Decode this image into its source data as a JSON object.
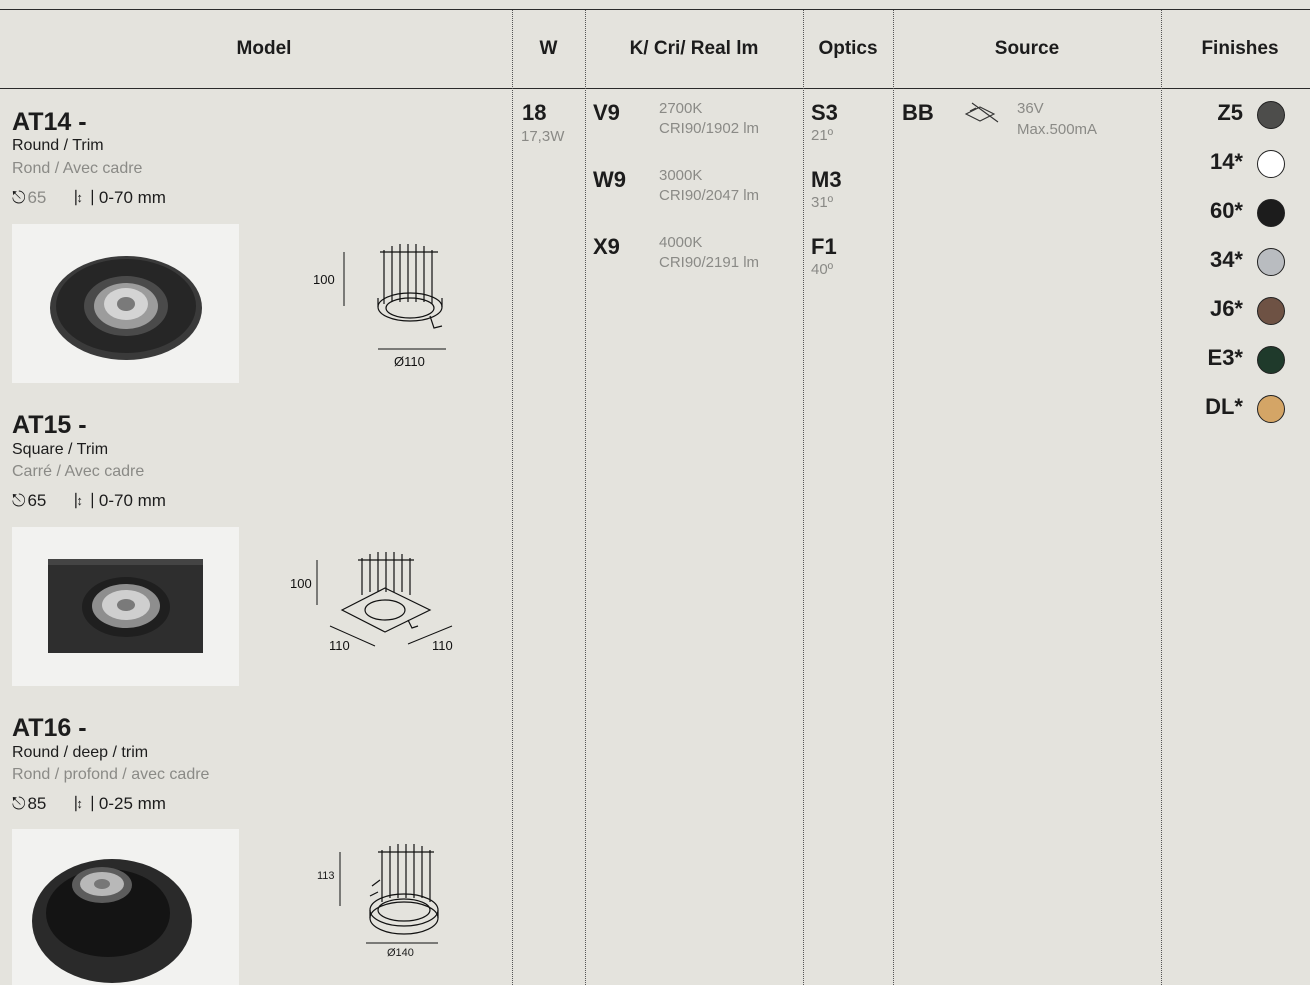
{
  "header": {
    "model": "Model",
    "w": "W",
    "k_cri": "K/ Cri/ Real lm",
    "optics": "Optics",
    "source": "Source",
    "finishes": "Finishes"
  },
  "models": [
    {
      "code": "AT14 -",
      "name_en": "Round / Trim",
      "name_fr": "Rond / Avec cadre",
      "ip": "65",
      "depth": "0-70 mm",
      "dims": {
        "height": "100",
        "diameter": "Ø110"
      }
    },
    {
      "code": "AT15 -",
      "name_en": "Square / Trim",
      "name_fr": "Carré / Avec cadre",
      "ip": "65",
      "depth": "0-70 mm",
      "dims": {
        "height": "100",
        "width": "110",
        "length": "110"
      }
    },
    {
      "code": "AT16 -",
      "name_en": "Round / deep / trim",
      "name_fr": "Rond / profond / avec cadre",
      "ip": "85",
      "depth": "0-25 mm",
      "dims": {
        "height": "113",
        "diameter": "Ø140"
      }
    }
  ],
  "wattage": {
    "code": "18",
    "value": "17,3W"
  },
  "kcri": [
    {
      "code": "V9",
      "k": "2700K",
      "cri": "CRI90/1902 lm"
    },
    {
      "code": "W9",
      "k": "3000K",
      "cri": "CRI90/2047 lm"
    },
    {
      "code": "X9",
      "k": "4000K",
      "cri": "CRI90/2191 lm"
    }
  ],
  "optics": [
    {
      "code": "S3",
      "angle": "21º"
    },
    {
      "code": "M3",
      "angle": "31º"
    },
    {
      "code": "F1",
      "angle": "40º"
    }
  ],
  "source": {
    "code": "BB",
    "voltage": "36V",
    "current": "Max.500mA"
  },
  "finishes": [
    {
      "code": "Z5",
      "color": "#4d4d4b"
    },
    {
      "code": "14*",
      "color": "#ffffff"
    },
    {
      "code": "60*",
      "color": "#1c1c1c"
    },
    {
      "code": "34*",
      "color": "#b9bcc0"
    },
    {
      "code": "J6*",
      "color": "#6e5244"
    },
    {
      "code": "E3*",
      "color": "#1f3a2b"
    },
    {
      "code": "DL*",
      "color": "#d4a566"
    }
  ]
}
